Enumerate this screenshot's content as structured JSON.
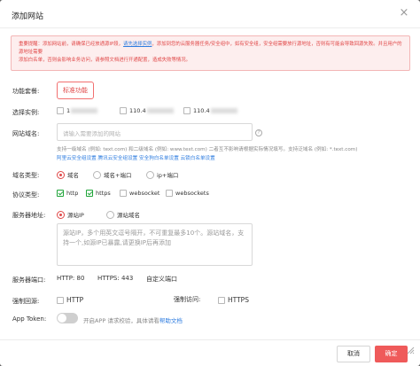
{
  "dialog": {
    "title": "添加网站",
    "close": "×"
  },
  "alert": {
    "part1": "重要提醒：添加网站前，请确保已经放通源IP段，",
    "link": "请先选择实例",
    "part2": "，添加到您的云服务器任务/安全组中，如有安全组，安全组需要放行源地址，否则有可能会导致回源失败。并且用户的源地址需要",
    "part3": "添加白名单，否则会影响业务访问，请参照文档进行开通配置，造成失败等情况。"
  },
  "package": {
    "label": "功能套餐:",
    "value": "标准功能"
  },
  "instance": {
    "label": "选择实例:",
    "options": [
      "1",
      "110.4",
      "110.4"
    ]
  },
  "domain": {
    "label": "网站域名:",
    "placeholder": "请输入需要添加的网站",
    "help1": "支持一级域名 (例如: text.com) 和二级域名 (例如: www.text.com) 二者互不影响请根据实际情况填写。支持泛域名 (例如: *.text.com)",
    "links": "阿里云安全组设置 腾讯云安全组设置 安全狗白名单设置 云锁白名单设置",
    "help_icon": "?"
  },
  "domain_type": {
    "label": "域名类型:",
    "options": [
      "域名",
      "域名+端口",
      "ip+端口"
    ]
  },
  "protocol": {
    "label": "协议类型:",
    "options": [
      "http",
      "https",
      "websocket",
      "websockets"
    ]
  },
  "server": {
    "label": "服务器地址:",
    "options": [
      "源站IP",
      "源站域名"
    ],
    "placeholder": "源站IP，多个用英文逗号隔开，不可重复最多10个。源站域名，支持一个,如源IP已暴露,请更换IP后再添加"
  },
  "port": {
    "label": "服务器端口:",
    "http": "HTTP: 80",
    "https": "HTTPS: 443",
    "custom": "自定义端口"
  },
  "force_back": {
    "label": "强制回源:",
    "option": "HTTP"
  },
  "force_visit": {
    "label": "强制访问:",
    "option": "HTTPS"
  },
  "app_token": {
    "label": "App Token:",
    "text": "开启APP 请求校验，具体请看",
    "link": "帮助文档"
  },
  "footer": {
    "cancel": "取消",
    "ok": "确定"
  }
}
